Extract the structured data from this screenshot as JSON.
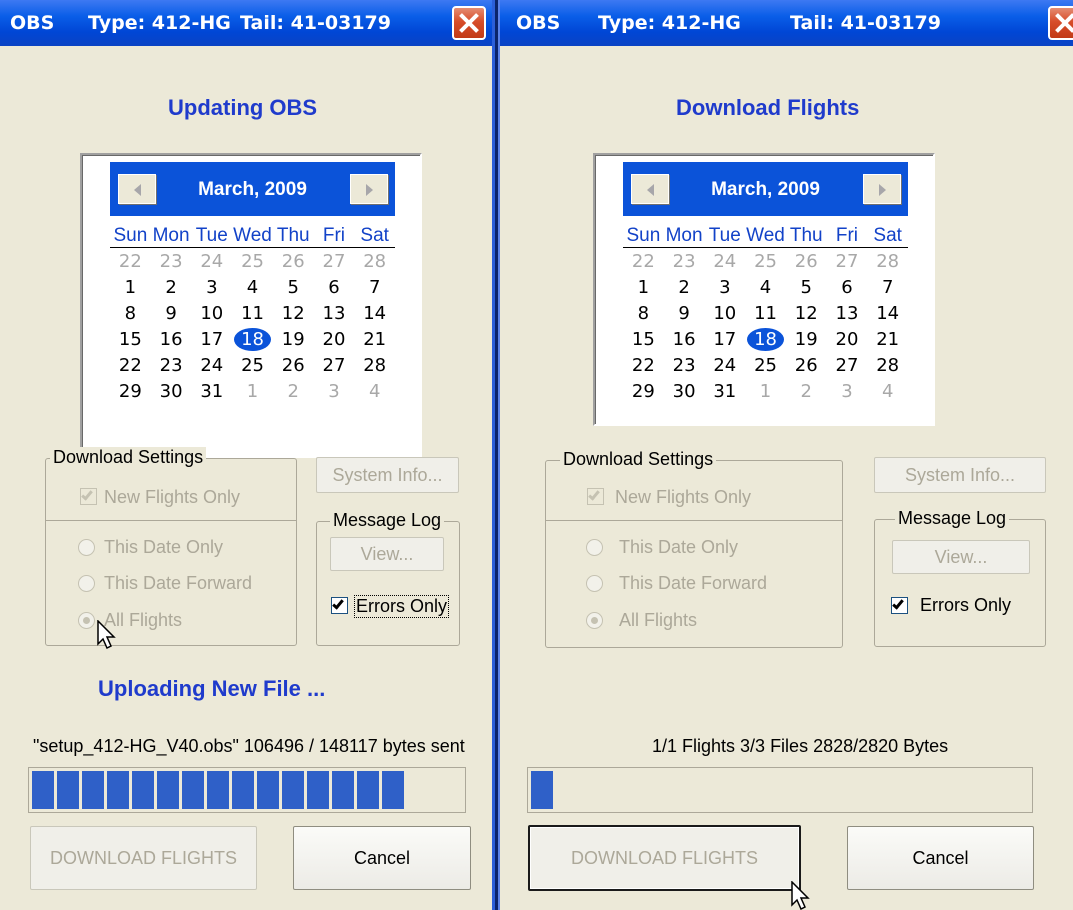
{
  "colors": {
    "titlebar": "#0a5ee8",
    "heading": "#1f3bcc",
    "calendar_header": "#0b53d9",
    "progress_fill": "#2f60c8",
    "window_bg": "#ece9d8"
  },
  "windows": [
    {
      "title": {
        "app": "OBS",
        "type": "Type: 412-HG",
        "tail": "Tail: 41-03179"
      },
      "heading": "Updating OBS",
      "calendar": {
        "month": "March, 2009",
        "days_of_week": [
          "Sun",
          "Mon",
          "Tue",
          "Wed",
          "Thu",
          "Fri",
          "Sat"
        ],
        "weeks": [
          [
            "22",
            "23",
            "24",
            "25",
            "26",
            "27",
            "28"
          ],
          [
            "1",
            "2",
            "3",
            "4",
            "5",
            "6",
            "7"
          ],
          [
            "8",
            "9",
            "10",
            "11",
            "12",
            "13",
            "14"
          ],
          [
            "15",
            "16",
            "17",
            "18",
            "19",
            "20",
            "21"
          ],
          [
            "22",
            "23",
            "24",
            "25",
            "26",
            "27",
            "28"
          ],
          [
            "29",
            "30",
            "31",
            "1",
            "2",
            "3",
            "4"
          ]
        ],
        "selected": "18"
      },
      "download_settings": {
        "label": "Download Settings",
        "new_flights_only": "New Flights Only",
        "this_date_only": "This Date Only",
        "this_date_forward": "This Date Forward",
        "all_flights": "All Flights"
      },
      "system_info": "System Info...",
      "message_log": {
        "label": "Message Log",
        "view": "View...",
        "errors_only": "Errors Only"
      },
      "status_big": "Uploading New File ...",
      "status_line": "\"setup_412-HG_V40.obs\"  106496 / 148117 bytes sent",
      "progress": {
        "fraction": 0.719,
        "blocks": 15
      },
      "download_button": "DOWNLOAD FLIGHTS",
      "cancel_button": "Cancel"
    },
    {
      "title": {
        "app": "OBS",
        "type": "Type: 412-HG",
        "tail": "Tail: 41-03179"
      },
      "heading": "Download Flights",
      "calendar": {
        "month": "March, 2009",
        "days_of_week": [
          "Sun",
          "Mon",
          "Tue",
          "Wed",
          "Thu",
          "Fri",
          "Sat"
        ],
        "weeks": [
          [
            "22",
            "23",
            "24",
            "25",
            "26",
            "27",
            "28"
          ],
          [
            "1",
            "2",
            "3",
            "4",
            "5",
            "6",
            "7"
          ],
          [
            "8",
            "9",
            "10",
            "11",
            "12",
            "13",
            "14"
          ],
          [
            "15",
            "16",
            "17",
            "18",
            "19",
            "20",
            "21"
          ],
          [
            "22",
            "23",
            "24",
            "25",
            "26",
            "27",
            "28"
          ],
          [
            "29",
            "30",
            "31",
            "1",
            "2",
            "3",
            "4"
          ]
        ],
        "selected": "18"
      },
      "download_settings": {
        "label": "Download Settings",
        "new_flights_only": "New Flights Only",
        "this_date_only": "This Date Only",
        "this_date_forward": "This Date Forward",
        "all_flights": "All Flights"
      },
      "system_info": "System Info...",
      "message_log": {
        "label": "Message Log",
        "view": "View...",
        "errors_only": "Errors Only"
      },
      "status_line": "1/1 Flights  3/3 Files  2828/2820 Bytes",
      "progress": {
        "fraction": 0.05,
        "blocks": 1
      },
      "download_button": "DOWNLOAD FLIGHTS",
      "cancel_button": "Cancel"
    }
  ]
}
